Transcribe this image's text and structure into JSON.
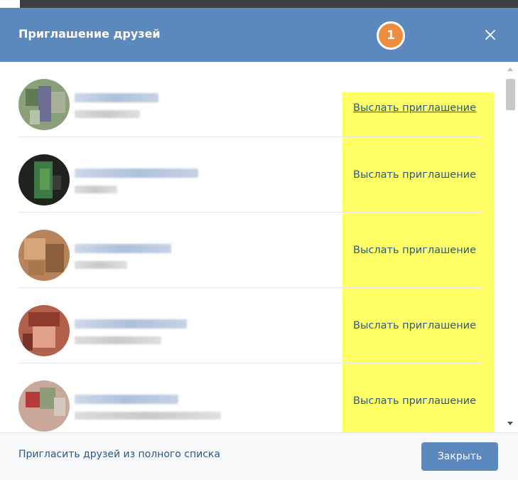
{
  "dialog": {
    "title": "Приглашение друзей",
    "step_badge": "1"
  },
  "icons": {
    "close": "close-icon",
    "avatar": "avatar-photo-icon",
    "scroll_up": "scroll-up-arrow-icon",
    "scroll_down": "scroll-down-arrow-icon"
  },
  "friends": [
    {
      "invite_label": "Выслать приглашение"
    },
    {
      "invite_label": "Выслать приглашение"
    },
    {
      "invite_label": "Выслать приглашение"
    },
    {
      "invite_label": "Выслать приглашение"
    },
    {
      "invite_label": "Выслать приглашение"
    }
  ],
  "footer": {
    "invite_all_label": "Пригласить друзей из полного списка",
    "close_label": "Закрыть"
  },
  "colors": {
    "header": "#5b88bd",
    "badge": "#ee8d3f",
    "highlight": "#ffff66",
    "link": "#2a5885"
  }
}
